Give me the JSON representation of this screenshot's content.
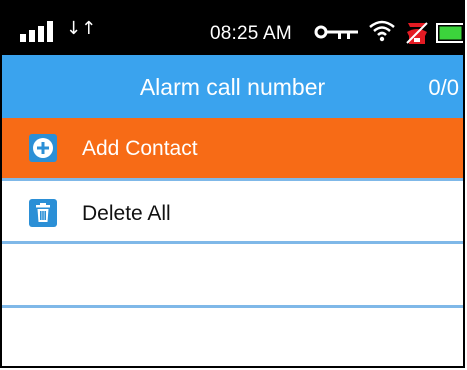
{
  "status_bar": {
    "time": "08:25 AM",
    "icons": [
      "signal-icon",
      "data-arrows-icon",
      "key-icon",
      "wifi-icon",
      "alarm-icon",
      "battery-icon"
    ],
    "data_arrows_glyph": "↓↑",
    "battery_color": "#3cd43c"
  },
  "header": {
    "title": "Alarm call number",
    "count": "0/0",
    "background": "#3aa3ee"
  },
  "list": {
    "items": [
      {
        "label": "Add Contact",
        "icon": "add-circle-icon",
        "background": "#f76b16"
      },
      {
        "label": "Delete All",
        "icon": "trash-icon",
        "background": "#ffffff"
      }
    ]
  }
}
